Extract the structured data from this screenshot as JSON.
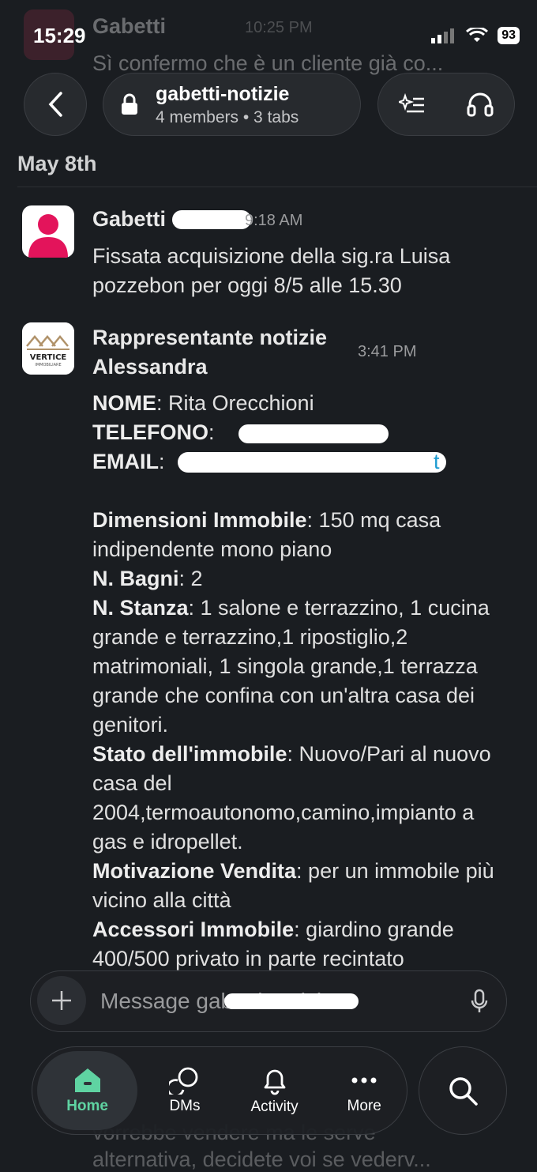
{
  "status_bar": {
    "time": "15:29",
    "battery": "93"
  },
  "prev_message": {
    "name": "Gabetti",
    "time": "10:25 PM",
    "text": "Sì confermo che è un cliente già co..."
  },
  "header": {
    "channel_title": "gabetti-notizie",
    "channel_sub": "4 members • 3 tabs"
  },
  "date_header": "May 8th",
  "messages": [
    {
      "name": "Gabetti",
      "time": "9:18 AM",
      "text": "Fissata acquisizione della sig.ra Luisa pozzebon  per oggi 8/5 alle 15.30"
    },
    {
      "name_line1": "Rappresentante notizie",
      "name_line2": "Alessandra",
      "time": "3:41 PM",
      "avatar_text": "VERTICE",
      "avatar_sub": "IMMOBILIARE",
      "fields": {
        "nome_label": "NOME",
        "nome_value": ": Rita Orecchioni",
        "telefono_label": "TELEFONO",
        "telefono_value": ": ",
        "email_label": "EMAIL",
        "email_value": ": ",
        "email_tail": "t",
        "dim_label": "Dimensioni Immobile",
        "dim_value": ": 150 mq casa indipendente mono piano",
        "bagni_label": "N. Bagni",
        "bagni_value": ": 2",
        "stanza_label": "N. Stanza",
        "stanza_value": ": 1 salone e terrazzino, 1 cucina grande e terrazzino,1 ripostiglio,2 matrimoniali, 1 singola grande,1 terrazza grande che confina con un'altra casa dei genitori.",
        "stato_label": "Stato dell'immobile",
        "stato_value": ": Nuovo/Pari al nuovo casa del 2004,termoautonomo,camino,impianto a gas e idropellet.",
        "motiv_label": "Motivazione Vendita",
        "motiv_value": ": per un immobile più vicino alla città",
        "acc_label": "Accessori Immobile",
        "acc_value": ": giardino grande 400/500 privato in parte recintato"
      }
    }
  ],
  "behind_lines": [
    "vorrebbe vendere ma le serve",
    "alternativa, decidete voi se vederv..."
  ],
  "composer": {
    "placeholder": "Message gabetti-notizie"
  },
  "nav": {
    "home": "Home",
    "dms": "DMs",
    "activity": "Activity",
    "more": "More"
  },
  "colors": {
    "accent_green": "#5fd3a2",
    "link": "#1d9bd1",
    "background": "#1a1d21"
  }
}
